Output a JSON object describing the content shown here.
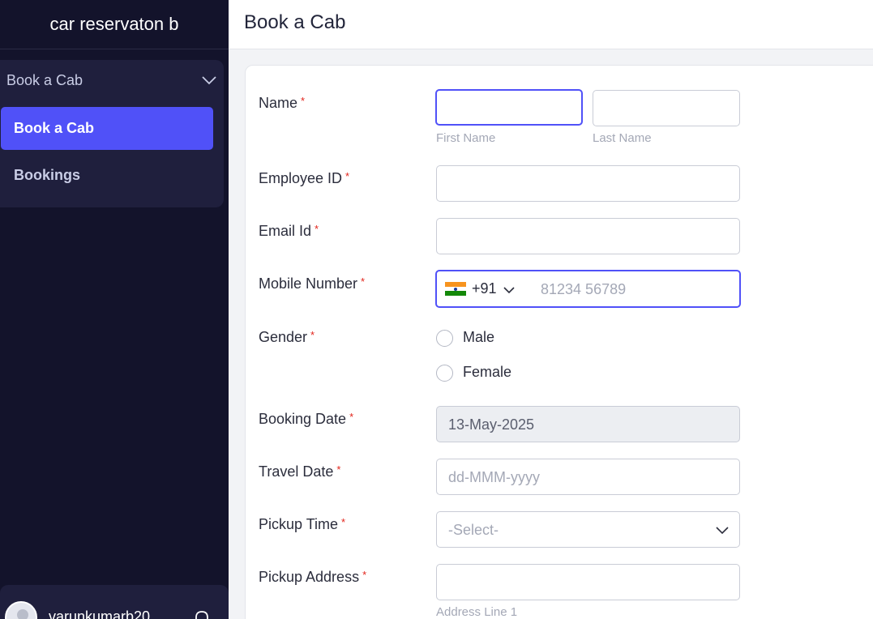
{
  "app": {
    "title": "car reservaton b"
  },
  "sidebar": {
    "group_label": "Book a Cab",
    "items": [
      {
        "label": "Book a Cab",
        "active": true
      },
      {
        "label": "Bookings",
        "active": false
      }
    ],
    "user": {
      "name": "varunkumarb20"
    }
  },
  "header": {
    "title": "Book a Cab"
  },
  "form": {
    "required_mark": "*",
    "name": {
      "label": "Name",
      "first_sub": "First Name",
      "last_sub": "Last Name",
      "first_value": "",
      "last_value": ""
    },
    "employee_id": {
      "label": "Employee ID",
      "value": ""
    },
    "email": {
      "label": "Email Id",
      "value": ""
    },
    "mobile": {
      "label": "Mobile Number",
      "country_code": "+91",
      "placeholder": "81234 56789"
    },
    "gender": {
      "label": "Gender",
      "options": [
        "Male",
        "Female"
      ]
    },
    "booking_date": {
      "label": "Booking Date",
      "value": "13-May-2025"
    },
    "travel_date": {
      "label": "Travel Date",
      "placeholder": "dd-MMM-yyyy"
    },
    "pickup_time": {
      "label": "Pickup Time",
      "selected": "-Select-"
    },
    "pickup_address": {
      "label": "Pickup Address",
      "sub": "Address Line 1",
      "value": ""
    }
  },
  "colors": {
    "accent": "#5051f8",
    "sidebar_bg": "#13132b",
    "sidebar_panel": "#1f1f3d",
    "required": "#e2241b"
  },
  "icons": {
    "menu_chevron": "chevron-down-icon",
    "bell": "bell-icon",
    "flag": "india-flag-icon"
  }
}
